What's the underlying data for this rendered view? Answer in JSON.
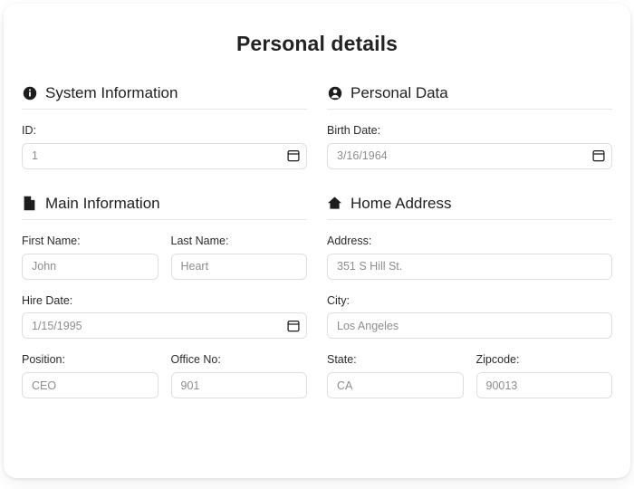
{
  "page": {
    "title": "Personal details"
  },
  "sections": [
    {
      "id": "system-information",
      "title": "System Information",
      "icon": "info-circle-icon",
      "column": "left",
      "rows": [
        {
          "fields": [
            {
              "name": "id",
              "label": "ID:",
              "value": "1",
              "trailing_icon": "calendar-icon"
            }
          ]
        }
      ]
    },
    {
      "id": "personal-data",
      "title": "Personal Data",
      "icon": "user-circle-icon",
      "column": "right",
      "rows": [
        {
          "fields": [
            {
              "name": "birth-date",
              "label": "Birth Date:",
              "value": "3/16/1964",
              "trailing_icon": "calendar-icon"
            }
          ]
        }
      ]
    },
    {
      "id": "main-information",
      "title": "Main Information",
      "icon": "document-icon",
      "column": "left",
      "rows": [
        {
          "fields": [
            {
              "name": "first-name",
              "label": "First Name:",
              "value": "John",
              "trailing_icon": null
            },
            {
              "name": "last-name",
              "label": "Last Name:",
              "value": "Heart",
              "trailing_icon": null
            }
          ]
        },
        {
          "fields": [
            {
              "name": "hire-date",
              "label": "Hire Date:",
              "value": "1/15/1995",
              "trailing_icon": "calendar-icon"
            }
          ]
        },
        {
          "fields": [
            {
              "name": "position",
              "label": "Position:",
              "value": "CEO",
              "trailing_icon": null
            },
            {
              "name": "office-no",
              "label": "Office No:",
              "value": "901",
              "trailing_icon": null
            }
          ]
        }
      ]
    },
    {
      "id": "home-address",
      "title": "Home Address",
      "icon": "home-icon",
      "column": "right",
      "rows": [
        {
          "fields": [
            {
              "name": "address",
              "label": "Address:",
              "value": "351 S Hill St.",
              "trailing_icon": null
            }
          ]
        },
        {
          "fields": [
            {
              "name": "city",
              "label": "City:",
              "value": "Los Angeles",
              "trailing_icon": null
            }
          ]
        },
        {
          "fields": [
            {
              "name": "state",
              "label": "State:",
              "value": "CA",
              "trailing_icon": null
            },
            {
              "name": "zipcode",
              "label": "Zipcode:",
              "value": "90013",
              "trailing_icon": null
            }
          ]
        }
      ]
    }
  ],
  "colors": {
    "card_background": "#ffffff",
    "page_background": "#ffffff",
    "title_text": "#232323",
    "label_text": "#2a2a2a",
    "input_text": "#8d8d8d",
    "input_border": "#dedede",
    "divider": "#e6e6e6",
    "icon": "#1d1d1d"
  }
}
